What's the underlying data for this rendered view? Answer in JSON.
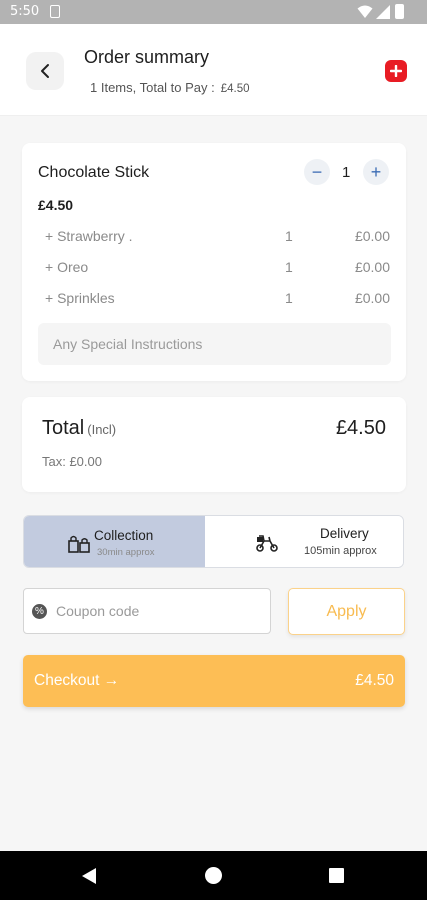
{
  "status_bar": {
    "time": "5:50",
    "icons": [
      "sim-card-icon",
      "wifi-icon",
      "signal-icon",
      "battery-icon"
    ]
  },
  "header": {
    "title": "Order summary",
    "subtitle": "1  Items, Total to Pay :",
    "subtitle_amount": "£4.50",
    "back_icon": "chevron-left-icon",
    "add_icon": "plus-square-icon",
    "accent_color": "#e81c24"
  },
  "item": {
    "name": "Chocolate Stick",
    "price": "£4.50",
    "quantity": "1",
    "minus_label": "−",
    "plus_label": "+",
    "options": [
      {
        "name": "+ Strawberry .",
        "qty": "1",
        "price": "£0.00"
      },
      {
        "name": "+ Oreo",
        "qty": "1",
        "price": "£0.00"
      },
      {
        "name": "+ Sprinkles",
        "qty": "1",
        "price": "£0.00"
      }
    ],
    "special_instructions_placeholder": "Any Special Instructions"
  },
  "totals": {
    "label": "Total",
    "label_note": "(Incl)",
    "amount": "£4.50",
    "tax": "Tax: £0.00"
  },
  "fulfillment": {
    "selected": "collection",
    "selected_color": "#c2cbdf",
    "collection": {
      "title": "Collection",
      "sub": "30min approx",
      "icon": "collection-bag-icon"
    },
    "delivery": {
      "title": "Delivery",
      "sub": "105min approx",
      "icon": "delivery-scooter-icon"
    }
  },
  "coupon": {
    "placeholder": "Coupon code",
    "icon": "percent-badge-icon",
    "apply_label": "Apply"
  },
  "checkout": {
    "label": "Checkout →",
    "amount": "£4.50",
    "color": "#fdbe55"
  },
  "nav_bar": {
    "icons": [
      "back-triangle-icon",
      "home-circle-icon",
      "recents-square-icon"
    ]
  }
}
